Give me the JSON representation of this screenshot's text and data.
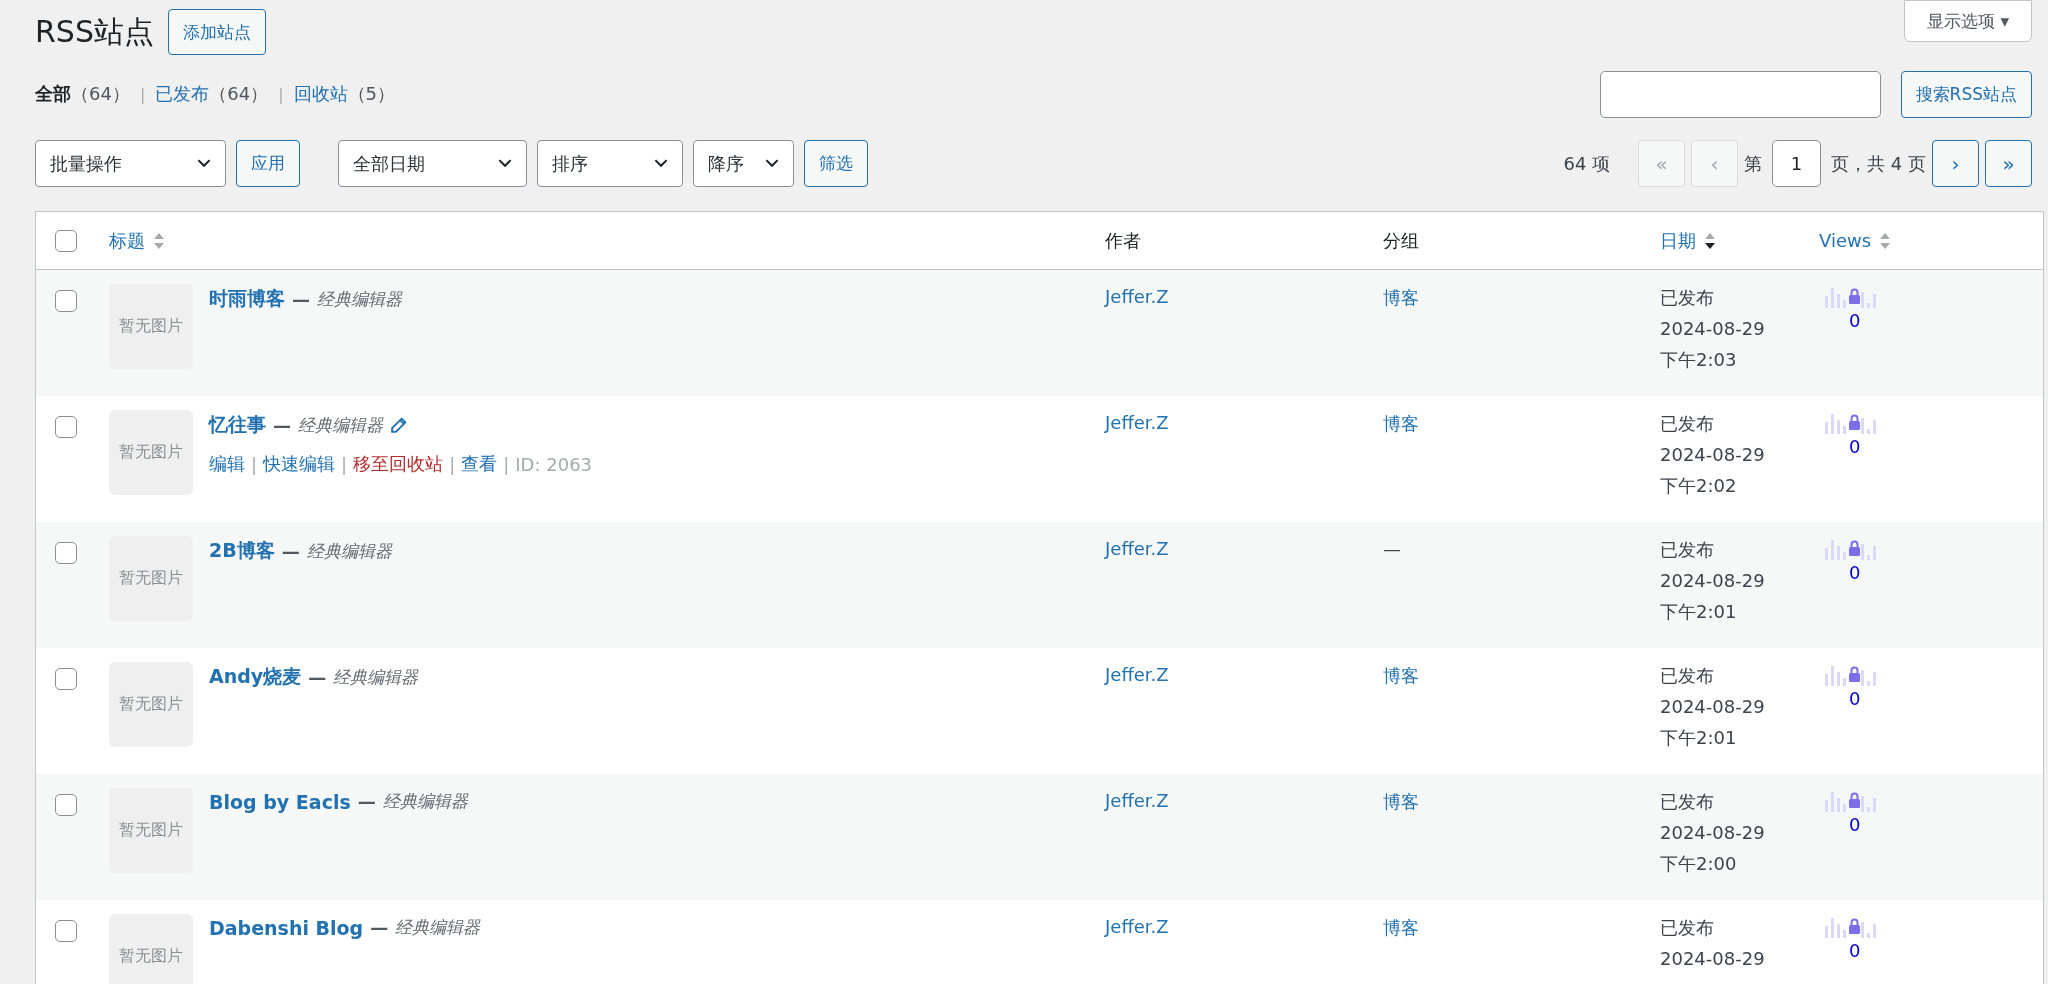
{
  "header": {
    "title": "RSS站点",
    "add_button": "添加站点",
    "screen_options": "显示选项 ▾"
  },
  "views": [
    {
      "label": "全部",
      "count": "（64）",
      "selected": true
    },
    {
      "label": "已发布",
      "count": "（64）",
      "selected": false
    },
    {
      "label": "回收站",
      "count": "（5）",
      "selected": false
    }
  ],
  "view_separator": "|",
  "search": {
    "button": "搜索RSS站点"
  },
  "bulk_actions": {
    "select": "批量操作",
    "apply": "应用"
  },
  "filters": {
    "selects": [
      "全部日期",
      "排序",
      "降序"
    ],
    "button": "筛选"
  },
  "pagination": {
    "count": "64 项",
    "before": [
      {
        "label": "«",
        "disabled": true
      },
      {
        "label": "‹",
        "disabled": true
      }
    ],
    "page_prefix": "第",
    "page": "1",
    "page_suffix": "页，共 4 页",
    "after": [
      {
        "label": "›",
        "disabled": false
      },
      {
        "label": "»",
        "disabled": false
      }
    ]
  },
  "table": {
    "select_all_checked": false,
    "title_separator": "—",
    "action_separator": "|",
    "columns": [
      {
        "label": "标题",
        "kind": "sortable",
        "sorted_desc": false
      },
      {
        "label": "作者",
        "kind": "plain"
      },
      {
        "label": "分组",
        "kind": "plain"
      },
      {
        "label": "日期",
        "kind": "sortable",
        "sorted_desc": true
      },
      {
        "label": "Views",
        "kind": "sortable",
        "sorted_desc": false
      }
    ],
    "rows": [
      {
        "checked": false,
        "thumb": "暂无图片",
        "title": "时雨博客",
        "editor": "经典编辑器",
        "editing": false,
        "actions": [],
        "author": "Jeffer.Z",
        "category": "博客",
        "category_linked": true,
        "date": [
          "已发布",
          "2024-08-29",
          "下午2:03"
        ],
        "views": "0"
      },
      {
        "checked": false,
        "thumb": "暂无图片",
        "title": "忆往事",
        "editor": "经典编辑器",
        "editing": true,
        "actions": [
          {
            "label": "编辑",
            "kind": "link"
          },
          {
            "label": "快速编辑",
            "kind": "link"
          },
          {
            "label": "移至回收站",
            "kind": "trash"
          },
          {
            "label": "查看",
            "kind": "link"
          },
          {
            "label": "ID: 2063",
            "kind": "id"
          }
        ],
        "author": "Jeffer.Z",
        "category": "博客",
        "category_linked": true,
        "date": [
          "已发布",
          "2024-08-29",
          "下午2:02"
        ],
        "views": "0"
      },
      {
        "checked": false,
        "thumb": "暂无图片",
        "title": "2B博客",
        "editor": "经典编辑器",
        "editing": false,
        "actions": [],
        "author": "Jeffer.Z",
        "category": "—",
        "category_linked": false,
        "date": [
          "已发布",
          "2024-08-29",
          "下午2:01"
        ],
        "views": "0"
      },
      {
        "checked": false,
        "thumb": "暂无图片",
        "title": "Andy烧麦",
        "editor": "经典编辑器",
        "editing": false,
        "actions": [],
        "author": "Jeffer.Z",
        "category": "博客",
        "category_linked": true,
        "date": [
          "已发布",
          "2024-08-29",
          "下午2:01"
        ],
        "views": "0"
      },
      {
        "checked": false,
        "thumb": "暂无图片",
        "title": "Blog by Eacls",
        "editor": "经典编辑器",
        "editing": false,
        "actions": [],
        "author": "Jeffer.Z",
        "category": "博客",
        "category_linked": true,
        "date": [
          "已发布",
          "2024-08-29",
          "下午2:00"
        ],
        "views": "0"
      },
      {
        "checked": false,
        "thumb": "暂无图片",
        "title": "Dabenshi Blog",
        "editor": "经典编辑器",
        "editing": false,
        "actions": [],
        "author": "Jeffer.Z",
        "category": "博客",
        "category_linked": true,
        "date": [
          "已发布",
          "2024-08-29"
        ],
        "views": "0"
      }
    ]
  }
}
